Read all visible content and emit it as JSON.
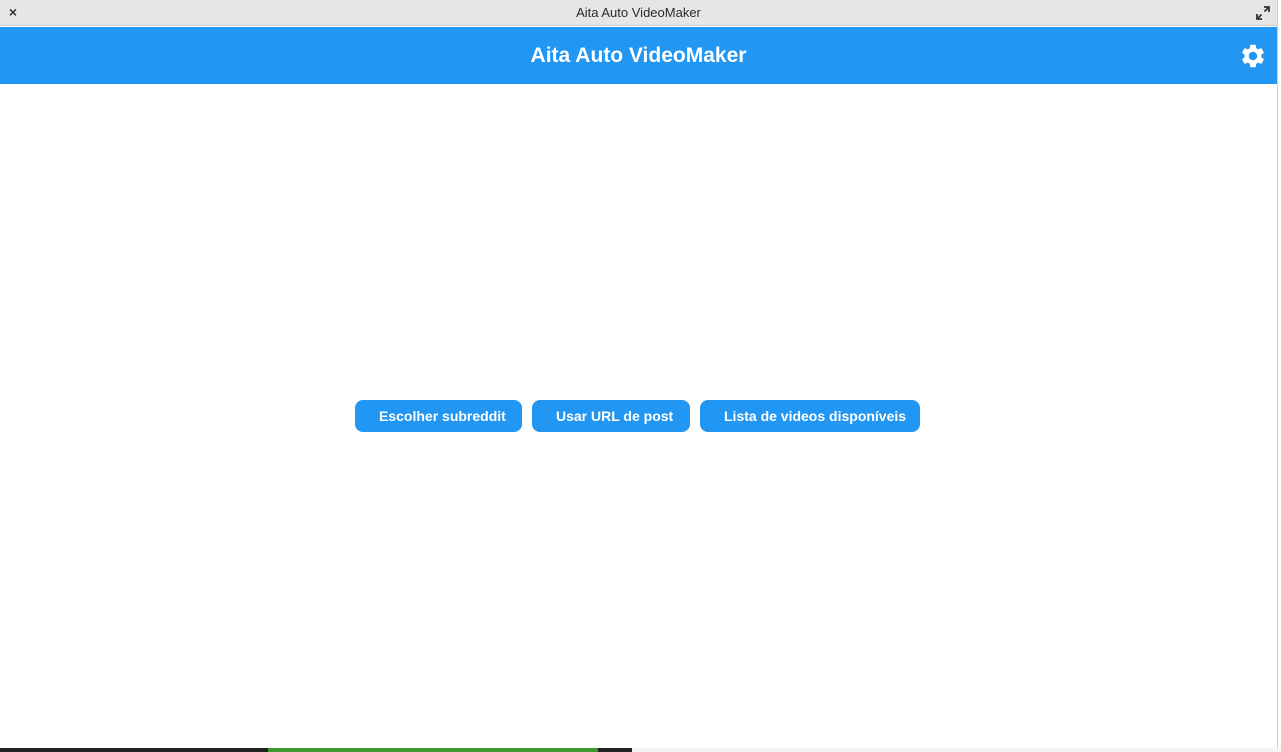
{
  "window": {
    "title": "Aita Auto VideoMaker",
    "close_glyph": "×",
    "maximize_icon": "maximize-icon"
  },
  "appbar": {
    "title": "Aita Auto VideoMaker",
    "settings_icon": "gear-icon",
    "color": "#2196f3"
  },
  "actions": [
    {
      "label": "Escolher subreddit"
    },
    {
      "label": "Usar URL de post"
    },
    {
      "label": "Lista de videos disponíveis"
    }
  ]
}
